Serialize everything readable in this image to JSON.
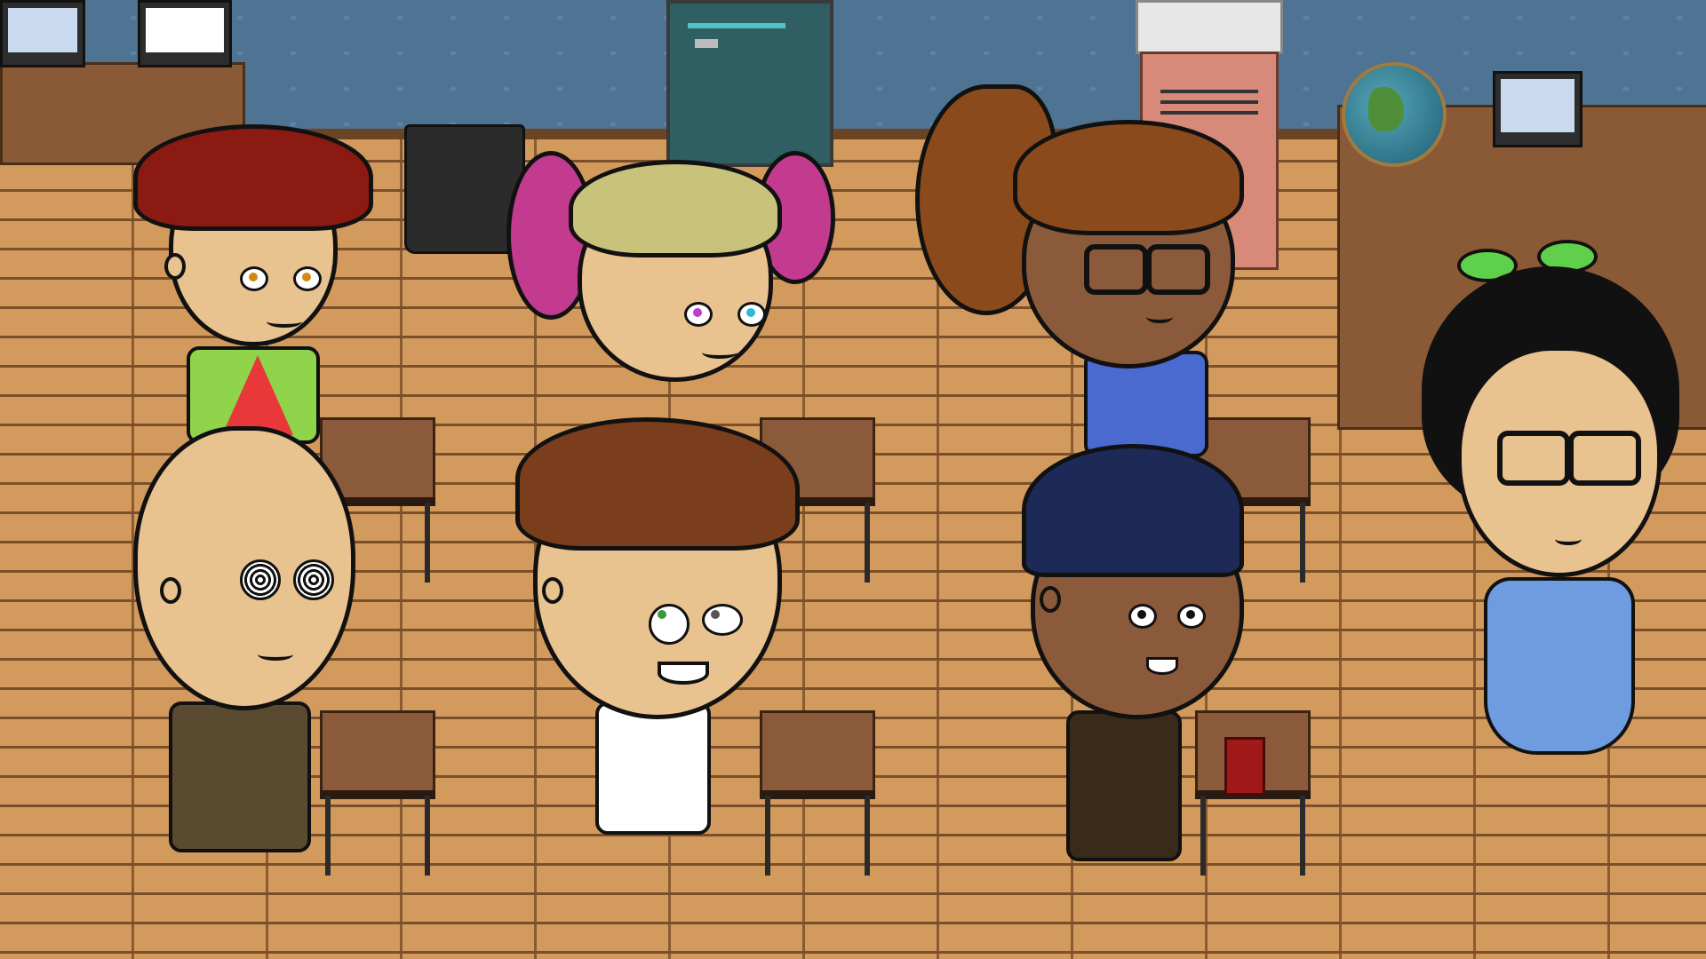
{
  "scene": {
    "type": "classroom",
    "palette": {
      "wall": "#4f7393",
      "floor": "#d39a5e",
      "desk": "#8a5a3a"
    }
  },
  "props": [
    {
      "name": "computer-left-1",
      "icon": "computer-monitor-icon"
    },
    {
      "name": "computer-left-2",
      "icon": "computer-monitor-icon"
    },
    {
      "name": "trash-can",
      "icon": "trash-can-icon"
    },
    {
      "name": "classroom-door",
      "icon": "door-icon"
    },
    {
      "name": "lockers",
      "icon": "locker-icon"
    },
    {
      "name": "globe",
      "icon": "globe-icon"
    },
    {
      "name": "computer-right",
      "icon": "computer-monitor-icon"
    }
  ],
  "characters": [
    {
      "id": "red-hair-boy",
      "hair_color": "#8a1a12",
      "skin": "#e8c28f",
      "shirt": "#8fd44a",
      "mood": "grumpy"
    },
    {
      "id": "pigtail-girl",
      "hair_color": "#c8c27a",
      "hair_tips": "#c23b8f",
      "skin": "#e8c28f",
      "mood": "smiling"
    },
    {
      "id": "ponytail-girl",
      "hair_color": "#8b4a1c",
      "skin": "#8a5a3a",
      "shirt": "#4a6ad0",
      "mood": "smug"
    },
    {
      "id": "mohawk-boy",
      "hair_color": "#e8383a",
      "skin": "#e8c28f",
      "shirt": "#8fd44a",
      "mood": "dizzy"
    },
    {
      "id": "brown-hair-boy",
      "hair_color": "#7a3e1c",
      "skin": "#e8c28f",
      "shirt": "#ffffff",
      "mood": "worried"
    },
    {
      "id": "cap-boy",
      "cap_color": "#1d2a57",
      "skin": "#8a5a3a",
      "shirt": "#3a2a1a",
      "mood": "surprised"
    },
    {
      "id": "glasses-girl",
      "hair_color": "#111111",
      "bow_color": "#5fd04b",
      "skin": "#e8c28f",
      "dress": "#6f9be0",
      "mood": "unimpressed"
    }
  ]
}
